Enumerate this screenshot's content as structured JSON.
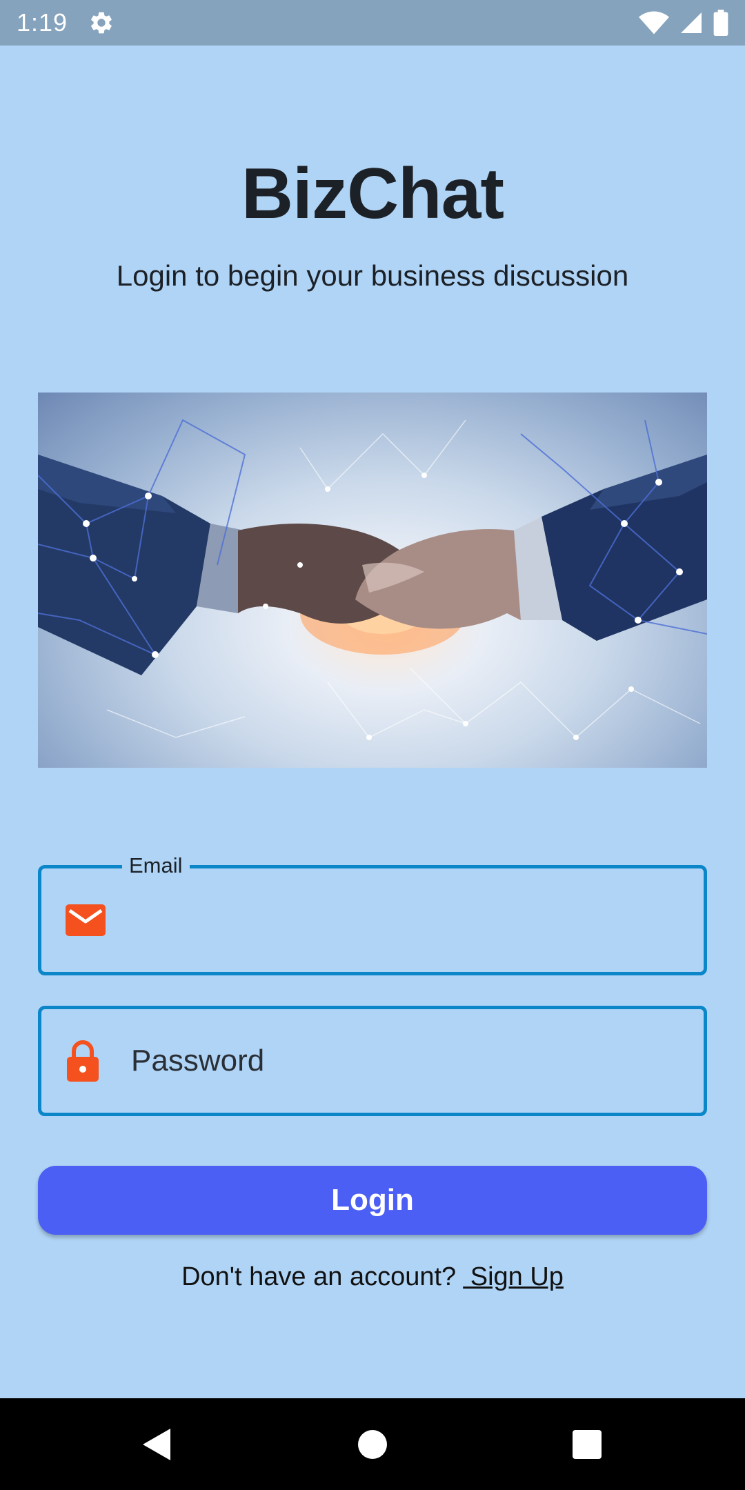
{
  "status_bar": {
    "time": "1:19",
    "icons": [
      "gear-icon",
      "wifi-icon",
      "signal-icon",
      "battery-icon"
    ]
  },
  "header": {
    "title": "BizChat",
    "subtitle": "Login to begin your business discussion"
  },
  "hero_image": {
    "subject": "handshake-network-illustration"
  },
  "form": {
    "email": {
      "label": "Email",
      "value": "",
      "placeholder": "",
      "icon": "mail-icon"
    },
    "password": {
      "label": "",
      "value": "",
      "placeholder": "Password",
      "icon": "lock-icon"
    },
    "login_label": "Login"
  },
  "signup": {
    "prompt": "Don't have an account?",
    "link_label": " Sign Up"
  },
  "colors": {
    "background": "#b0d4f6",
    "status_bar": "#85a3bd",
    "field_border": "#0a86c9",
    "icon_accent": "#f4511e",
    "button": "#4c5ff5",
    "title_text": "#1c2127"
  },
  "nav_bar": {
    "buttons": [
      "back-icon",
      "home-icon",
      "recents-icon"
    ]
  }
}
